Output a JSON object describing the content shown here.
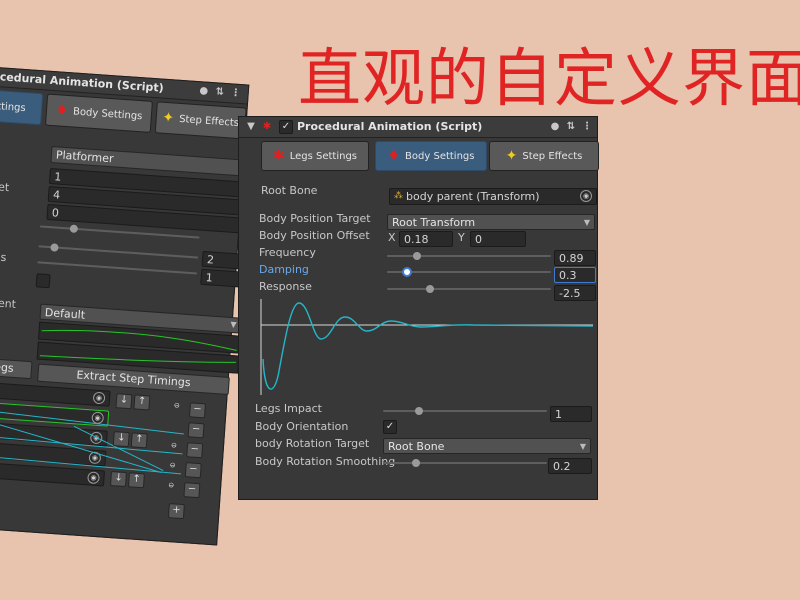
{
  "headline": "直观的自定义界面",
  "main_panel": {
    "title": "Procedural Animation (Script)",
    "tabs": [
      {
        "label": "Legs Settings"
      },
      {
        "label": "Body Settings",
        "active": true
      },
      {
        "label": "Step Effects"
      }
    ],
    "fields": {
      "root_bone": {
        "label": "Root Bone",
        "value": "body parent (Transform)"
      },
      "body_position_target": {
        "label": "Body Position Target",
        "value": "Root Transform"
      },
      "body_position_offset": {
        "label": "Body Position Offset",
        "x_label": "X",
        "x": "0.18",
        "y_label": "Y",
        "y": "0"
      },
      "frequency": {
        "label": "Frequency",
        "value": "0.89",
        "slider_fraction": 0.18
      },
      "damping": {
        "label": "Damping",
        "value": "0.3",
        "slider_fraction": 0.12
      },
      "response": {
        "label": "Response",
        "value": "-2.5",
        "slider_fraction": 0.26
      },
      "legs_impact": {
        "label": "Legs Impact",
        "value": "1",
        "slider_fraction": 0.22
      },
      "body_orientation": {
        "label": "Body Orientation",
        "checked": true
      },
      "body_rotation_target": {
        "label": "body Rotation Target",
        "value": "Root Bone"
      },
      "body_rotation_smoothing": {
        "label": "Body Rotation Smoothing",
        "value": "0.2",
        "slider_fraction": 0.2
      }
    },
    "curve_color": "#25b6c9"
  },
  "back_panel": {
    "title": "ocedural Animation (Script)",
    "tabs": [
      {
        "label": "Settings",
        "active": true
      },
      {
        "label": "Body Settings"
      },
      {
        "label": "Step Effects"
      }
    ],
    "labels": {
      "row1": "e",
      "row2": "fset",
      "row3": "l",
      "row4": "ings",
      "row5": "ement"
    },
    "values": {
      "mode": "Platformer",
      "v1": "1",
      "v2": "4",
      "v3": "0",
      "v4": "2",
      "v5": "1",
      "preset": "Default"
    },
    "buttons": {
      "legs": "Legs",
      "extract": "Extract Step Timings",
      "plus": "+"
    },
    "list_items": [
      "m)",
      "m)",
      ")",
      ")",
      ")"
    ]
  }
}
